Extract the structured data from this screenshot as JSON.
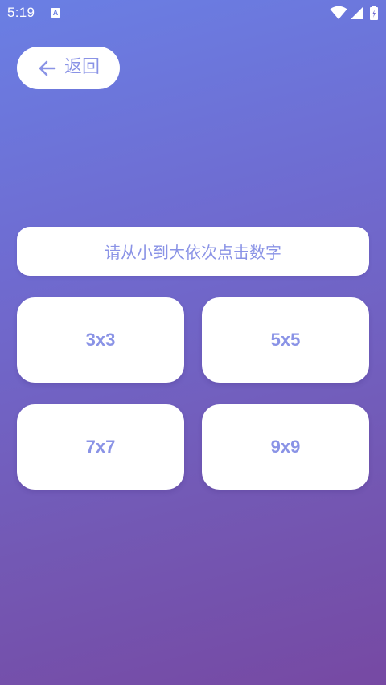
{
  "status_bar": {
    "time": "5:19",
    "notification_icon": "A",
    "icons": [
      "a-notification-icon",
      "wifi-icon",
      "signal-icon",
      "battery-icon"
    ]
  },
  "back": {
    "label": "返回",
    "icon": "arrow-left-icon"
  },
  "instruction": "请从小到大依次点击数字",
  "grid_options": [
    {
      "label": "3x3"
    },
    {
      "label": "5x5"
    },
    {
      "label": "7x7"
    },
    {
      "label": "9x9"
    }
  ],
  "colors": {
    "background_top": "#6a7fe4",
    "background_bottom": "#7649a3",
    "accent_text": "#8a93e6",
    "card": "#ffffff"
  }
}
